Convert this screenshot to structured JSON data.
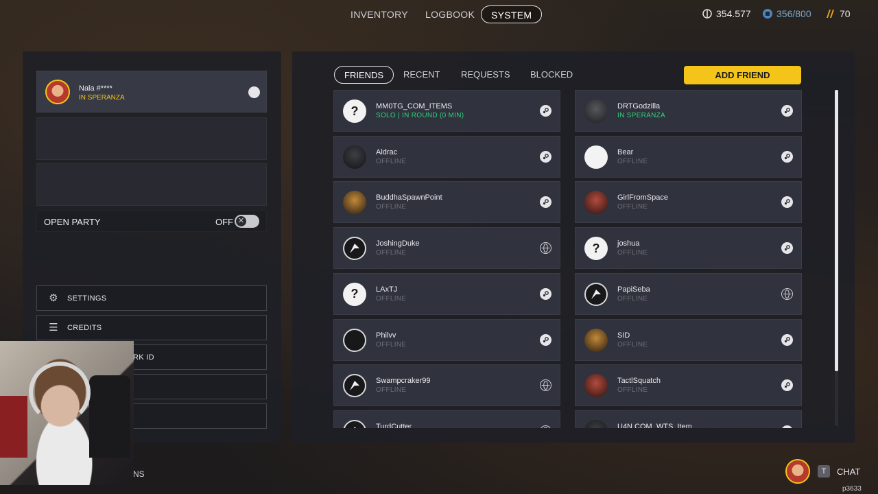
{
  "nav": {
    "tabs": [
      "INVENTORY",
      "LOGBOOK",
      "SYSTEM"
    ],
    "active": "SYSTEM"
  },
  "currencies": [
    {
      "icon": "credits-icon",
      "value": "354.577",
      "color": "#e8e8ea"
    },
    {
      "icon": "storage-icon",
      "value": "356/800",
      "color": "#7aa6c8"
    },
    {
      "icon": "aurum-icon",
      "value": "70",
      "color": "#e8e8ea"
    }
  ],
  "profile": {
    "name": "Nala #****",
    "status": "IN SPERANZA",
    "status_color": "#f4c518"
  },
  "open_party": {
    "label": "OPEN PARTY",
    "state": "OFF"
  },
  "menu": [
    {
      "label": "SETTINGS",
      "icon": "gear-icon"
    },
    {
      "label": "CREDITS",
      "icon": "list-icon"
    },
    {
      "label": "RK ID",
      "icon": ""
    },
    {
      "label": "",
      "icon": ""
    },
    {
      "label": "",
      "icon": ""
    }
  ],
  "bottom_left_text": "NS",
  "friends_tabs": [
    "FRIENDS",
    "RECENT",
    "REQUESTS",
    "BLOCKED"
  ],
  "friends_active_tab": "FRIENDS",
  "add_friend_label": "ADD FRIEND",
  "friends": [
    {
      "name": "MM0TG_COM_ITEMS",
      "status": "SOLO | IN ROUND (0 MIN)",
      "online": true,
      "avatar": "question-avatar",
      "platform": "steam-icon"
    },
    {
      "name": "DRTGodzilla",
      "status": "IN SPERANZA",
      "online": true,
      "avatar": "skull-avatar",
      "platform": "steam-icon"
    },
    {
      "name": "Aldrac",
      "status": "OFFLINE",
      "online": false,
      "avatar": "dark-avatar",
      "platform": "steam-icon"
    },
    {
      "name": "Bear",
      "status": "OFFLINE",
      "online": false,
      "avatar": "bear-avatar",
      "platform": "steam-icon"
    },
    {
      "name": "BuddhaSpawnPoint",
      "status": "OFFLINE",
      "online": false,
      "avatar": "gold-avatar",
      "platform": "steam-icon"
    },
    {
      "name": "GirlFromSpace",
      "status": "OFFLINE",
      "online": false,
      "avatar": "red-avatar",
      "platform": "steam-icon"
    },
    {
      "name": "JoshingDuke",
      "status": "OFFLINE",
      "online": false,
      "avatar": "pcc-avatar",
      "platform": "globe-icon"
    },
    {
      "name": "joshua",
      "status": "OFFLINE",
      "online": false,
      "avatar": "question-avatar",
      "platform": "steam-icon"
    },
    {
      "name": "LAxTJ",
      "status": "OFFLINE",
      "online": false,
      "avatar": "question-avatar",
      "platform": "steam-icon"
    },
    {
      "name": "PapiSeba",
      "status": "OFFLINE",
      "online": false,
      "avatar": "pcc-avatar",
      "platform": "globe-icon"
    },
    {
      "name": "Philvv",
      "status": "OFFLINE",
      "online": false,
      "avatar": "hooded-avatar",
      "platform": "steam-icon"
    },
    {
      "name": "SID",
      "status": "OFFLINE",
      "online": false,
      "avatar": "gold-avatar",
      "platform": "steam-icon"
    },
    {
      "name": "Swampcraker99",
      "status": "OFFLINE",
      "online": false,
      "avatar": "pcc-avatar",
      "platform": "globe-icon"
    },
    {
      "name": "TactlSquatch",
      "status": "OFFLINE",
      "online": false,
      "avatar": "red-avatar",
      "platform": "steam-icon"
    },
    {
      "name": "TurdCutter",
      "status": "",
      "online": false,
      "avatar": "pcc-avatar",
      "platform": "globe-icon"
    },
    {
      "name": "U4N COM_WTS_Item",
      "status": "",
      "online": false,
      "avatar": "dark-avatar",
      "platform": "steam-icon"
    }
  ],
  "chat": {
    "key": "T",
    "label": "CHAT"
  },
  "build": "p3633"
}
